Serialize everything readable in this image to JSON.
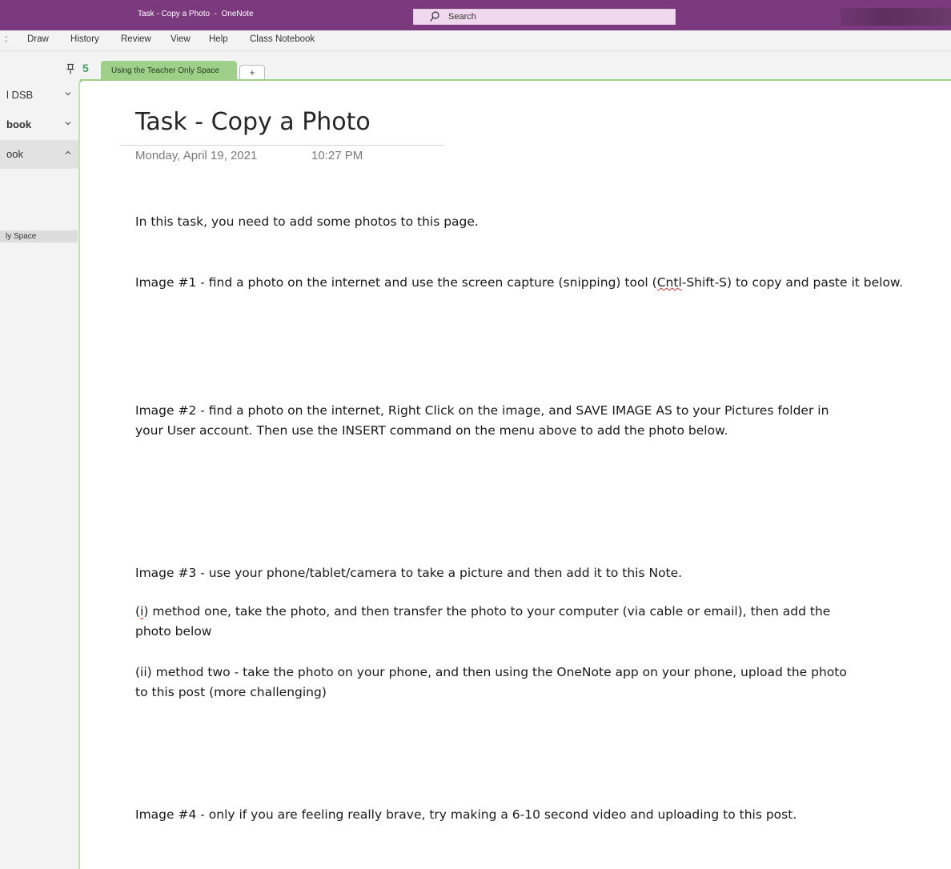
{
  "window": {
    "title": "Task - Copy a Photo  -  OneNote",
    "search_label": "Search"
  },
  "menu": {
    "stub": ":",
    "items": [
      "Draw",
      "History",
      "Review",
      "View",
      "Help",
      "Class Notebook"
    ]
  },
  "section_bar": {
    "back_glyph": "5",
    "active_tab": "Using the Teacher Only Space",
    "add_tab": "+"
  },
  "nav": {
    "items": [
      {
        "label": "l DSB"
      },
      {
        "label": "book"
      },
      {
        "label": "ook"
      }
    ],
    "page_label": "ly Space"
  },
  "page": {
    "title": "Task - Copy a Photo",
    "date": "Monday, April 19, 2021",
    "time": "10:27 PM",
    "p1": "In this task, you need to add some photos to this page.",
    "p2_before": "Image #1 - find a photo on the internet and use the screen capture (snipping) tool (",
    "p2_typo": "Cntl",
    "p2_after": "-Shift-S) to copy and paste it below.",
    "p3": "Image #2 - find a photo on the internet, Right Click on the image, and SAVE IMAGE AS to your Pictures folder in your User account.  Then use the INSERT command on the menu above to add the photo below.",
    "p4": "Image #3 - use your phone/tablet/camera to take a picture and then add it to this Note.",
    "p5_prefix": "(",
    "p5_typo": "i",
    "p5_rest": ") method one, take the photo, and then transfer the photo to your computer (via cable or email), then add the photo below",
    "p6": "(ii) method two - take the photo on your phone, and then using the OneNote app on your phone, upload the photo to this post (more challenging)",
    "p7": "Image #4 - only if you are feeling really brave, try making a 6-10 second video and uploading to this post."
  },
  "colors": {
    "titlebar": "#7b3a7d",
    "section_tab": "#9fd089",
    "spellcheck": "#d13438"
  }
}
